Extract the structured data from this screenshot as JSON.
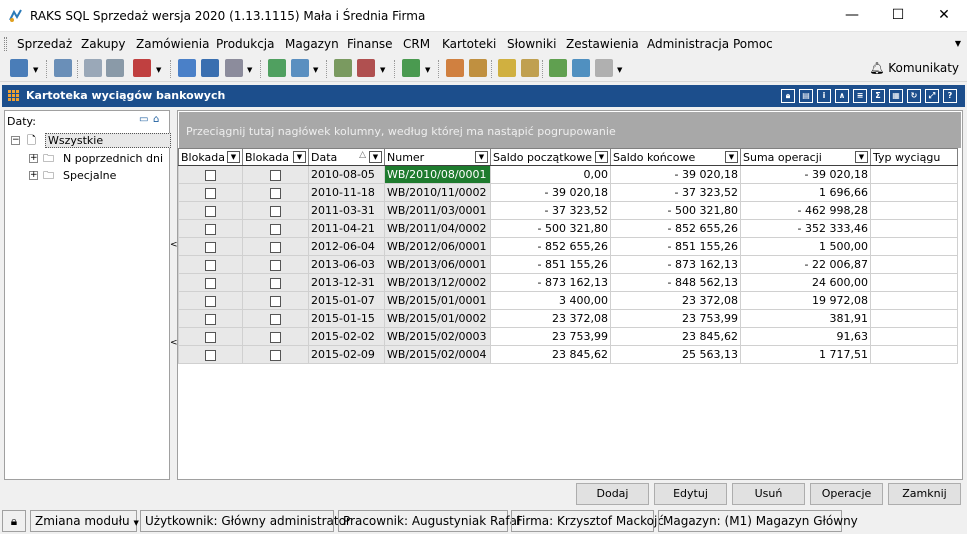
{
  "window": {
    "title": "RAKS SQL Sprzedaż wersja 2020 (1.13.1115) Mała i Średnia Firma",
    "minimize": "—",
    "maximize": "☐",
    "close": "✕"
  },
  "menu": {
    "items": [
      {
        "label": "Sprzedaż"
      },
      {
        "label": "Zakupy"
      },
      {
        "label": "Zamówienia"
      },
      {
        "label": "Produkcja"
      },
      {
        "label": "Magazyn"
      },
      {
        "label": "Finanse"
      },
      {
        "label": "CRM"
      },
      {
        "label": "Kartoteki"
      },
      {
        "label": "Słowniki"
      },
      {
        "label": "Zestawienia"
      },
      {
        "label": "Administracja"
      },
      {
        "label": "Pomoc"
      }
    ]
  },
  "toolbar": {
    "komunikaty_label": "Komunikaty"
  },
  "panel": {
    "title": "Kartoteka wyciągów bankowych"
  },
  "tree": {
    "label": "Daty:",
    "root": "Wszystkie",
    "children": [
      "N poprzednich dni",
      "Specjalne"
    ]
  },
  "grid": {
    "group_hint": "Przeciągnij tutaj nagłówek kolumny, według której ma nastąpić pogrupowanie",
    "columns": [
      "Blokada",
      "Blokada",
      "Data",
      "Numer",
      "Saldo początkowe",
      "Saldo końcowe",
      "Suma operacji",
      "Typ wyciągu"
    ],
    "rows": [
      {
        "date": "2010-08-05",
        "number": "WB/2010/08/0001",
        "start": "0,00",
        "end": "- 39 020,18",
        "sum": "- 39 020,18"
      },
      {
        "date": "2010-11-18",
        "number": "WB/2010/11/0002",
        "start": "- 39 020,18",
        "end": "- 37 323,52",
        "sum": "1 696,66"
      },
      {
        "date": "2011-03-31",
        "number": "WB/2011/03/0001",
        "start": "- 37 323,52",
        "end": "- 500 321,80",
        "sum": "- 462 998,28"
      },
      {
        "date": "2011-04-21",
        "number": "WB/2011/04/0002",
        "start": "- 500 321,80",
        "end": "- 852 655,26",
        "sum": "- 352 333,46"
      },
      {
        "date": "2012-06-04",
        "number": "WB/2012/06/0001",
        "start": "- 852 655,26",
        "end": "- 851 155,26",
        "sum": "1 500,00"
      },
      {
        "date": "2013-06-03",
        "number": "WB/2013/06/0001",
        "start": "- 851 155,26",
        "end": "- 873 162,13",
        "sum": "- 22 006,87"
      },
      {
        "date": "2013-12-31",
        "number": "WB/2013/12/0002",
        "start": "- 873 162,13",
        "end": "- 848 562,13",
        "sum": "24 600,00"
      },
      {
        "date": "2015-01-07",
        "number": "WB/2015/01/0001",
        "start": "3 400,00",
        "end": "23 372,08",
        "sum": "19 972,08"
      },
      {
        "date": "2015-01-15",
        "number": "WB/2015/01/0002",
        "start": "23 372,08",
        "end": "23 753,99",
        "sum": "381,91"
      },
      {
        "date": "2015-02-02",
        "number": "WB/2015/02/0003",
        "start": "23 753,99",
        "end": "23 845,62",
        "sum": "91,63"
      },
      {
        "date": "2015-02-09",
        "number": "WB/2015/02/0004",
        "start": "23 845,62",
        "end": "25 563,13",
        "sum": "1 717,51"
      }
    ]
  },
  "buttons": {
    "add": "Dodaj",
    "edit": "Edytuj",
    "delete": "Usuń",
    "operations": "Operacje",
    "close": "Zamknij"
  },
  "status": {
    "module": "Zmiana modułu",
    "user": "Użytkownik: Główny administrator",
    "employee": "Pracownik: Augustyniak Rafał",
    "company": "Firma: Krzysztof Mackojć",
    "warehouse": "Magazyn: (M1) Magazyn Główny"
  },
  "colors": {
    "header_blue": "#1c4e8c",
    "selected_green": "#1e7b2e",
    "group_bar": "#a8a8a8"
  }
}
